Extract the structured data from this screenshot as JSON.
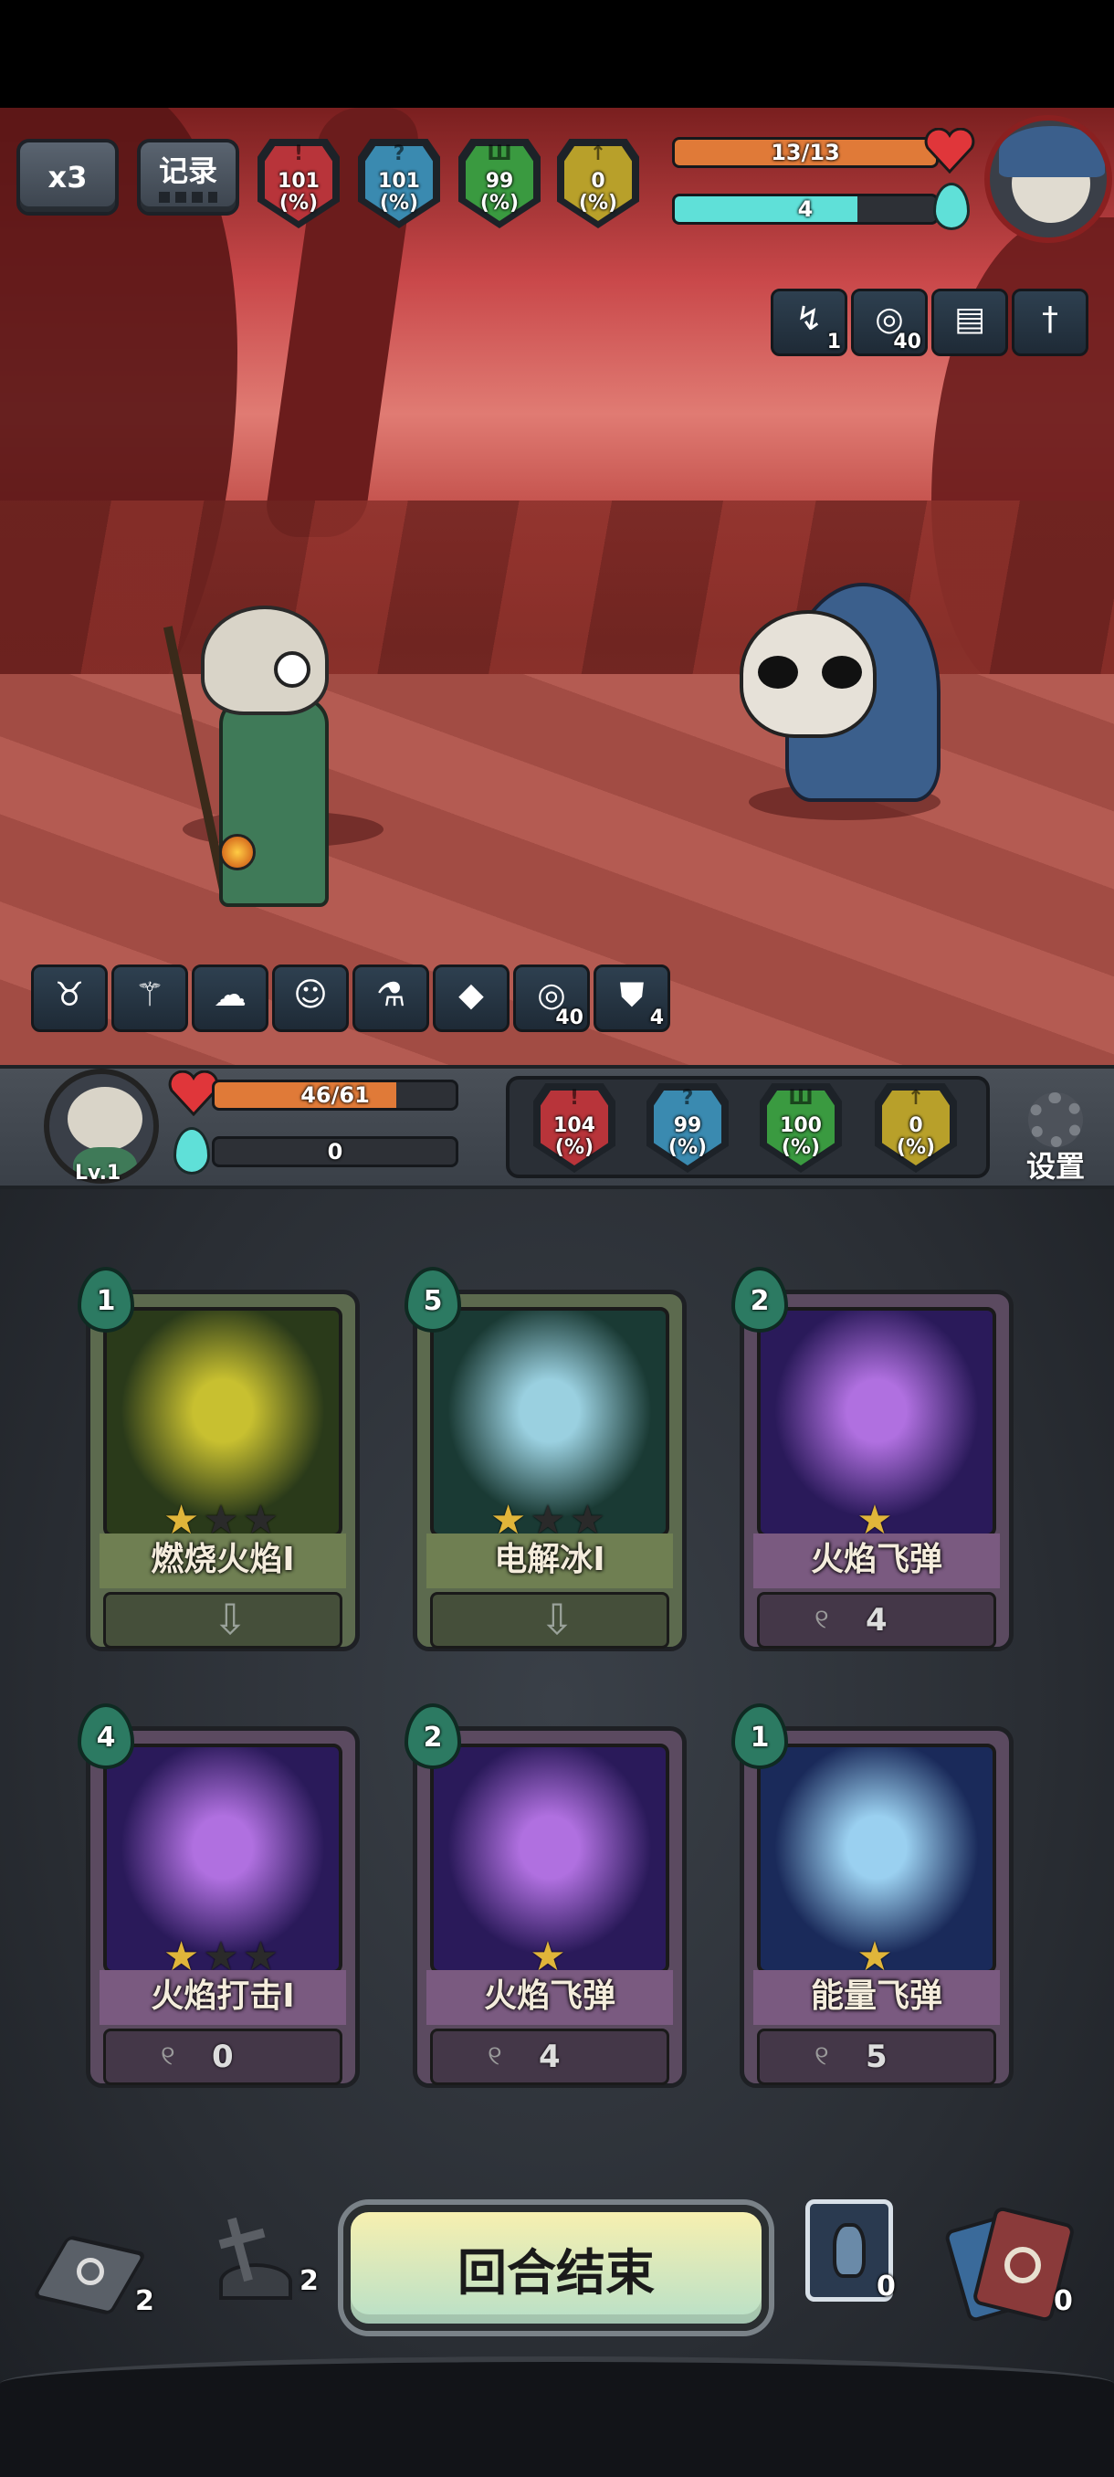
{
  "hud": {
    "speed_button": "x3",
    "log_button": "记录",
    "enemy_stats": [
      {
        "icon": "sword-attack-icon",
        "symbol": "!",
        "value": "101",
        "unit": "(%)",
        "color": "#b8343a"
      },
      {
        "icon": "question-crit-icon",
        "symbol": "?",
        "value": "101",
        "unit": "(%)",
        "color": "#3a8ab0"
      },
      {
        "icon": "armor-defense-icon",
        "symbol": "Ш",
        "value": "99",
        "unit": "(%)",
        "color": "#3a9a40"
      },
      {
        "icon": "arrow-speed-icon",
        "symbol": "↑",
        "value": "0",
        "unit": "(%)",
        "color": "#b8a02a"
      }
    ],
    "enemy_hp": {
      "text": "13/13",
      "fraction": 1.0,
      "color": "#e07a38"
    },
    "enemy_mana": {
      "text": "4",
      "fraction": 0.7,
      "color": "#5fe0d8"
    },
    "enemy_buffs": [
      {
        "icon": "lightning-down-icon",
        "glyph": "↯",
        "count": "1"
      },
      {
        "icon": "vortex-icon",
        "glyph": "◎",
        "count": "40"
      },
      {
        "icon": "spellbook-icon",
        "glyph": "▤",
        "count": ""
      },
      {
        "icon": "dagger-icon",
        "glyph": "†",
        "count": ""
      }
    ]
  },
  "player": {
    "level": "Lv.1",
    "hp": {
      "text": "46/61",
      "fraction": 0.754,
      "color": "#e07a38"
    },
    "mana": {
      "text": "0",
      "fraction": 0.0,
      "color": "#5fe0d8"
    },
    "stats": [
      {
        "icon": "sword-attack-icon",
        "symbol": "!",
        "value": "104",
        "unit": "(%)",
        "color": "#b8343a"
      },
      {
        "icon": "question-crit-icon",
        "symbol": "?",
        "value": "99",
        "unit": "(%)",
        "color": "#3a8ab0"
      },
      {
        "icon": "armor-defense-icon",
        "symbol": "Ш",
        "value": "100",
        "unit": "(%)",
        "color": "#3a9a40"
      },
      {
        "icon": "arrow-speed-icon",
        "symbol": "↑",
        "value": "0",
        "unit": "(%)",
        "color": "#b8a02a"
      }
    ],
    "settings_label": "设置",
    "buffs": [
      {
        "icon": "ox-head-icon",
        "glyph": "♉",
        "count": ""
      },
      {
        "icon": "wand-icon",
        "glyph": "⚚",
        "count": ""
      },
      {
        "icon": "cloud-swirl-icon",
        "glyph": "☁",
        "count": ""
      },
      {
        "icon": "pet-companion-icon",
        "glyph": "☺",
        "count": ""
      },
      {
        "icon": "potion-icon",
        "glyph": "⚗",
        "count": ""
      },
      {
        "icon": "crystal-icon",
        "glyph": "◆",
        "count": ""
      },
      {
        "icon": "vortex-icon",
        "glyph": "◎",
        "count": "40"
      },
      {
        "icon": "shield-icon",
        "glyph": "⛊",
        "count": "4"
      }
    ]
  },
  "cards": [
    {
      "cost": "1",
      "name": "燃烧火焰I",
      "stars_on": 1,
      "stars_total": 3,
      "style": "green",
      "footer": "arrow",
      "art_color": "#c8c030",
      "art_bg": "#2a3a1a"
    },
    {
      "cost": "5",
      "name": "电解冰I",
      "stars_on": 1,
      "stars_total": 3,
      "style": "green",
      "footer": "arrow",
      "art_color": "#9ad0e0",
      "art_bg": "#1a3a34"
    },
    {
      "cost": "2",
      "name": "火焰飞弹",
      "stars_on": 1,
      "stars_total": 1,
      "style": "purple",
      "footer": "4",
      "art_color": "#b070e0",
      "art_bg": "#2a1a5a"
    },
    {
      "cost": "4",
      "name": "火焰打击I",
      "stars_on": 1,
      "stars_total": 3,
      "style": "purple",
      "footer": "0",
      "art_color": "#b070e0",
      "art_bg": "#2a1a5a"
    },
    {
      "cost": "2",
      "name": "火焰飞弹",
      "stars_on": 1,
      "stars_total": 1,
      "style": "purple",
      "footer": "4",
      "art_color": "#b070e0",
      "art_bg": "#2a1a5a"
    },
    {
      "cost": "1",
      "name": "能量飞弹",
      "stars_on": 1,
      "stars_total": 1,
      "style": "purple",
      "footer": "5",
      "art_color": "#9ad0f0",
      "art_bg": "#1a2a5a"
    }
  ],
  "bottom": {
    "draw_pile_count": "2",
    "grave_count": "2",
    "end_turn_label": "回合结束",
    "potion_count": "0",
    "discard_count": "0"
  }
}
